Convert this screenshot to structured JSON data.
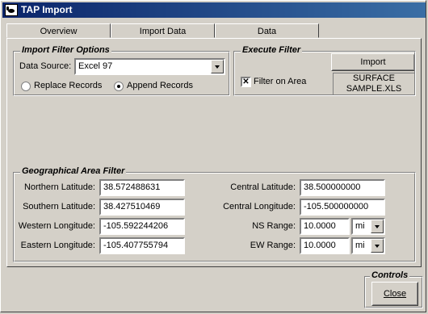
{
  "window": {
    "title": "TAP Import"
  },
  "tabs": [
    {
      "label": "Overview"
    },
    {
      "label": "Import Data"
    },
    {
      "label": "Data"
    }
  ],
  "import_filter": {
    "title": "Import Filter Options",
    "data_source_label": "Data Source:",
    "data_source_value": "Excel 97",
    "radio_replace": "Replace Records",
    "radio_append": "Append Records",
    "selected": "Append Records"
  },
  "execute_filter": {
    "title": "Execute Filter",
    "import_button": "Import",
    "filter_on_area_label": "Filter on Area",
    "filter_on_area_checked": "✕",
    "file_line1": "SURFACE",
    "file_line2": "SAMPLE.XLS"
  },
  "geo_filter": {
    "title": "Geographical Area Filter",
    "northern_lat_label": "Northern Latitude:",
    "northern_lat": "38.572488631",
    "southern_lat_label": "Southern Latitude:",
    "southern_lat": "38.427510469",
    "western_lon_label": "Western Longitude:",
    "western_lon": "-105.592244206",
    "eastern_lon_label": "Eastern Longitude:",
    "eastern_lon": "-105.407755794",
    "central_lat_label": "Central Latitude:",
    "central_lat": "38.500000000",
    "central_lon_label": "Central Longitude:",
    "central_lon": "-105.500000000",
    "ns_range_label": "NS Range:",
    "ns_range": "10.0000",
    "ns_unit": "mi",
    "ew_range_label": "EW Range:",
    "ew_range": "10.0000",
    "ew_unit": "mi"
  },
  "controls": {
    "title": "Controls",
    "close_button": "Close"
  }
}
